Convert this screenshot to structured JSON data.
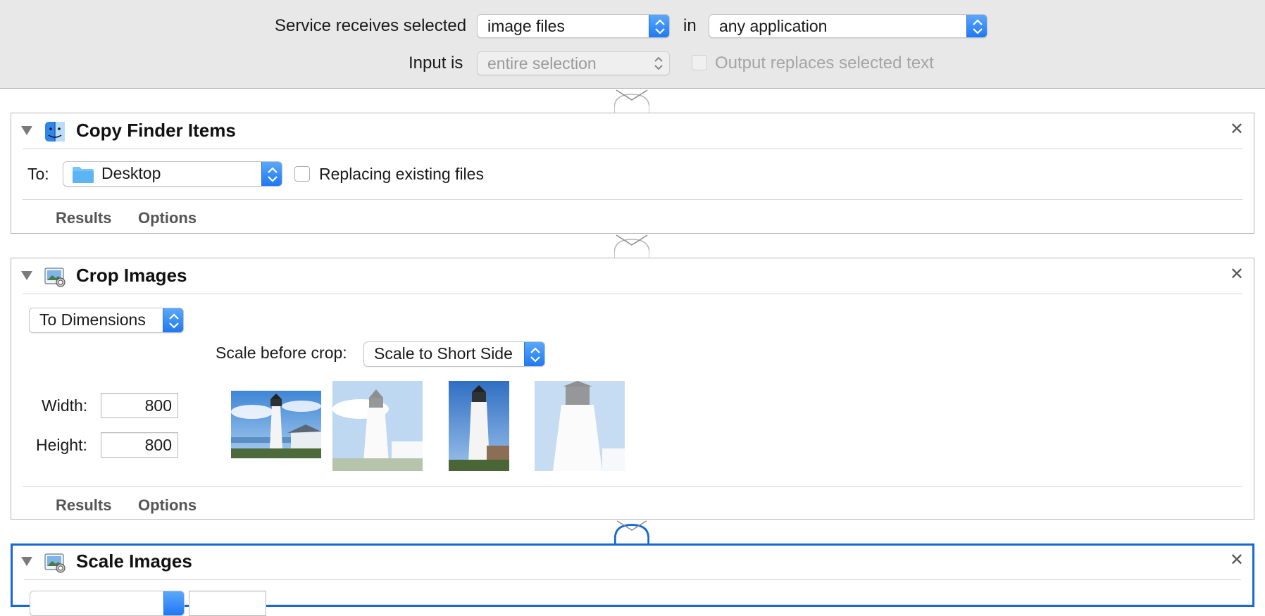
{
  "header": {
    "service_label": "Service receives selected",
    "service_value": "image files",
    "in_label": "in",
    "app_value": "any application",
    "input_label": "Input is",
    "input_value": "entire selection",
    "output_label": "Output replaces selected text"
  },
  "actions": [
    {
      "title": "Copy Finder Items",
      "to_label": "To:",
      "to_value": "Desktop",
      "replace_label": "Replacing existing files",
      "results_tab": "Results",
      "options_tab": "Options",
      "icon": "finder-icon"
    },
    {
      "title": "Crop Images",
      "mode_value": "To Dimensions",
      "scale_label": "Scale before crop:",
      "scale_value": "Scale to Short Side",
      "width_label": "Width:",
      "width_value": "800",
      "height_label": "Height:",
      "height_value": "800",
      "results_tab": "Results",
      "options_tab": "Options",
      "icon": "preview-icon"
    },
    {
      "title": "Scale Images",
      "icon": "preview-icon"
    }
  ],
  "colors": {
    "accent": "#1667d8",
    "header_bg": "#e8e8e8",
    "popup_blue": "#2078f4"
  }
}
